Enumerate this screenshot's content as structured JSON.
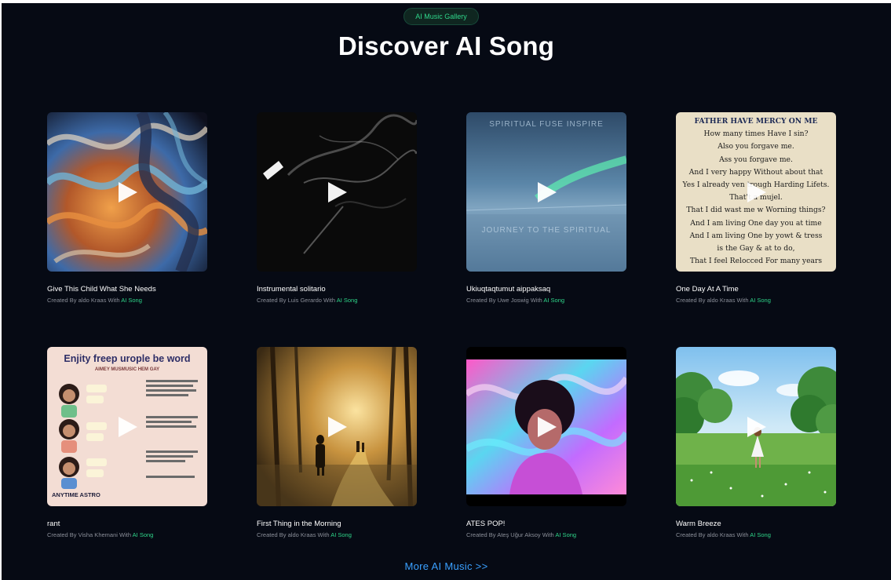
{
  "header": {
    "badge": "AI Music Gallery",
    "title": "Discover AI Song"
  },
  "songs": [
    {
      "title": "Give This Child What She Needs",
      "created_by": "Created By aldo Kraas With ",
      "brand": "AI Song"
    },
    {
      "title": "Instrumental solitario",
      "created_by": "Created By Luis Gerardo With ",
      "brand": "AI Song"
    },
    {
      "title": "Ukiuqtaqtumut aippaksaq",
      "created_by": "Created By Uwe Joswig With ",
      "brand": "AI Song"
    },
    {
      "title": "One Day At A Time",
      "created_by": "Created By aldo Kraas With ",
      "brand": "AI Song"
    },
    {
      "title": "rant",
      "created_by": "Created By Visha Khemani With ",
      "brand": "AI Song"
    },
    {
      "title": "First Thing in the Morning",
      "created_by": "Created By aldo Kraas With ",
      "brand": "AI Song"
    },
    {
      "title": "ATES POP!",
      "created_by": "Created By Ateş Uğur Aksoy With ",
      "brand": "AI Song"
    },
    {
      "title": "Warm Breeze",
      "created_by": "Created By aldo Kraas With ",
      "brand": "AI Song"
    }
  ],
  "covers": {
    "c3_top": "SPIRITUAL FUSE INSPIRE",
    "c3_bottom": "JOURNEY TO THE SPIRITUAL",
    "c4_lines": [
      "FATHER HAVE MERCY ON ME",
      "How many times Have I sin?",
      "Also you forgave me.",
      "Ass you forgave me.",
      "And I very happy Without about that",
      "Yes I already ven trough Harding Lifets.",
      "That't a mujel.",
      "That I did wast me w Worning things?",
      "And I am living One day you at time",
      "And I am living One by yowt & tress",
      "is the Gay & at to do,",
      "That I feel Relocced For many years"
    ],
    "c5_title": "Enjity freep urople be word",
    "c5_sub": "AIMEY MUSMUSIC HEM GAY",
    "c5_footer": "ANYTIME ASTRO"
  },
  "footer": {
    "more_link": "More AI Music >>"
  },
  "colors": {
    "background": "#060a14",
    "accent_green": "#2fd68a",
    "link_blue": "#3aa0ff"
  },
  "icons": {
    "play": "play-icon"
  }
}
